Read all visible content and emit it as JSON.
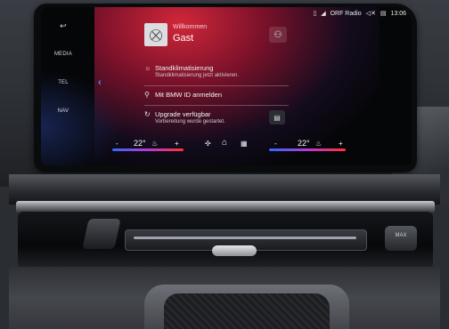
{
  "status_bar": {
    "radio_station": "ORF Radio",
    "time": "13:06",
    "icons": [
      "mobile-icon",
      "navigation-arrow-icon",
      "mute-icon",
      "message-icon"
    ]
  },
  "side_nav": {
    "back_icon": "back-arrow-icon",
    "items": [
      "MEDIA",
      "TEL",
      "NAV"
    ]
  },
  "welcome": {
    "greeting": "Willkommen",
    "name": "Gast"
  },
  "list": [
    {
      "icon": "climate-people-icon",
      "title": "Standklimatisierung",
      "subtitle": "Standklimatisierung jetzt aktivieren."
    },
    {
      "icon": "user-icon",
      "title": "Mit BMW ID anmelden",
      "subtitle": ""
    },
    {
      "icon": "update-circle-icon",
      "title": "Upgrade verfügbar",
      "subtitle": "Vorbereitung wurde gestartet."
    }
  ],
  "climate": {
    "left_temp": "22°",
    "right_temp": "22°",
    "minus": "-",
    "plus": "+"
  },
  "hardware": {
    "max_button_label": "MAX"
  },
  "colors": {
    "accent_red": "#d8283c",
    "accent_blue": "#3aa0ff"
  }
}
